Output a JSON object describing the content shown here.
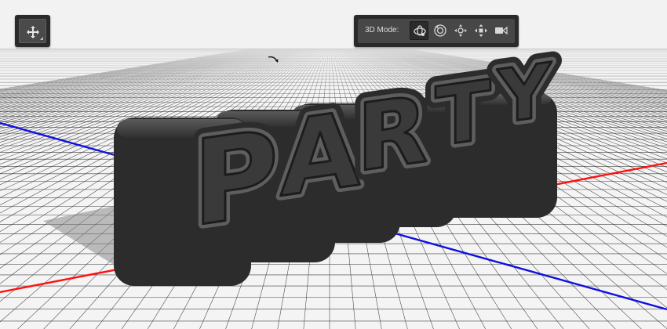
{
  "toolbox": {
    "active_tool_icon": "move-icon"
  },
  "mode_bar": {
    "label": "3D Mode:",
    "buttons": [
      {
        "icon": "rotate-3d-icon",
        "active": true
      },
      {
        "icon": "roll-3d-icon",
        "active": false
      },
      {
        "icon": "pan-3d-icon",
        "active": false
      },
      {
        "icon": "slide-3d-icon",
        "active": false
      },
      {
        "icon": "scale-3d-icon",
        "active": false
      }
    ]
  },
  "scene": {
    "text": "PARTY",
    "colors": {
      "floor_background": "#f4f4f4",
      "grid_lines": "#222222",
      "x_axis": "#ff1010",
      "z_axis": "#1010e0",
      "extrusion_side": "#2c2c2c",
      "letter_face": "#3a3a3a",
      "bevel_highlight": "#5e5e5e"
    }
  }
}
